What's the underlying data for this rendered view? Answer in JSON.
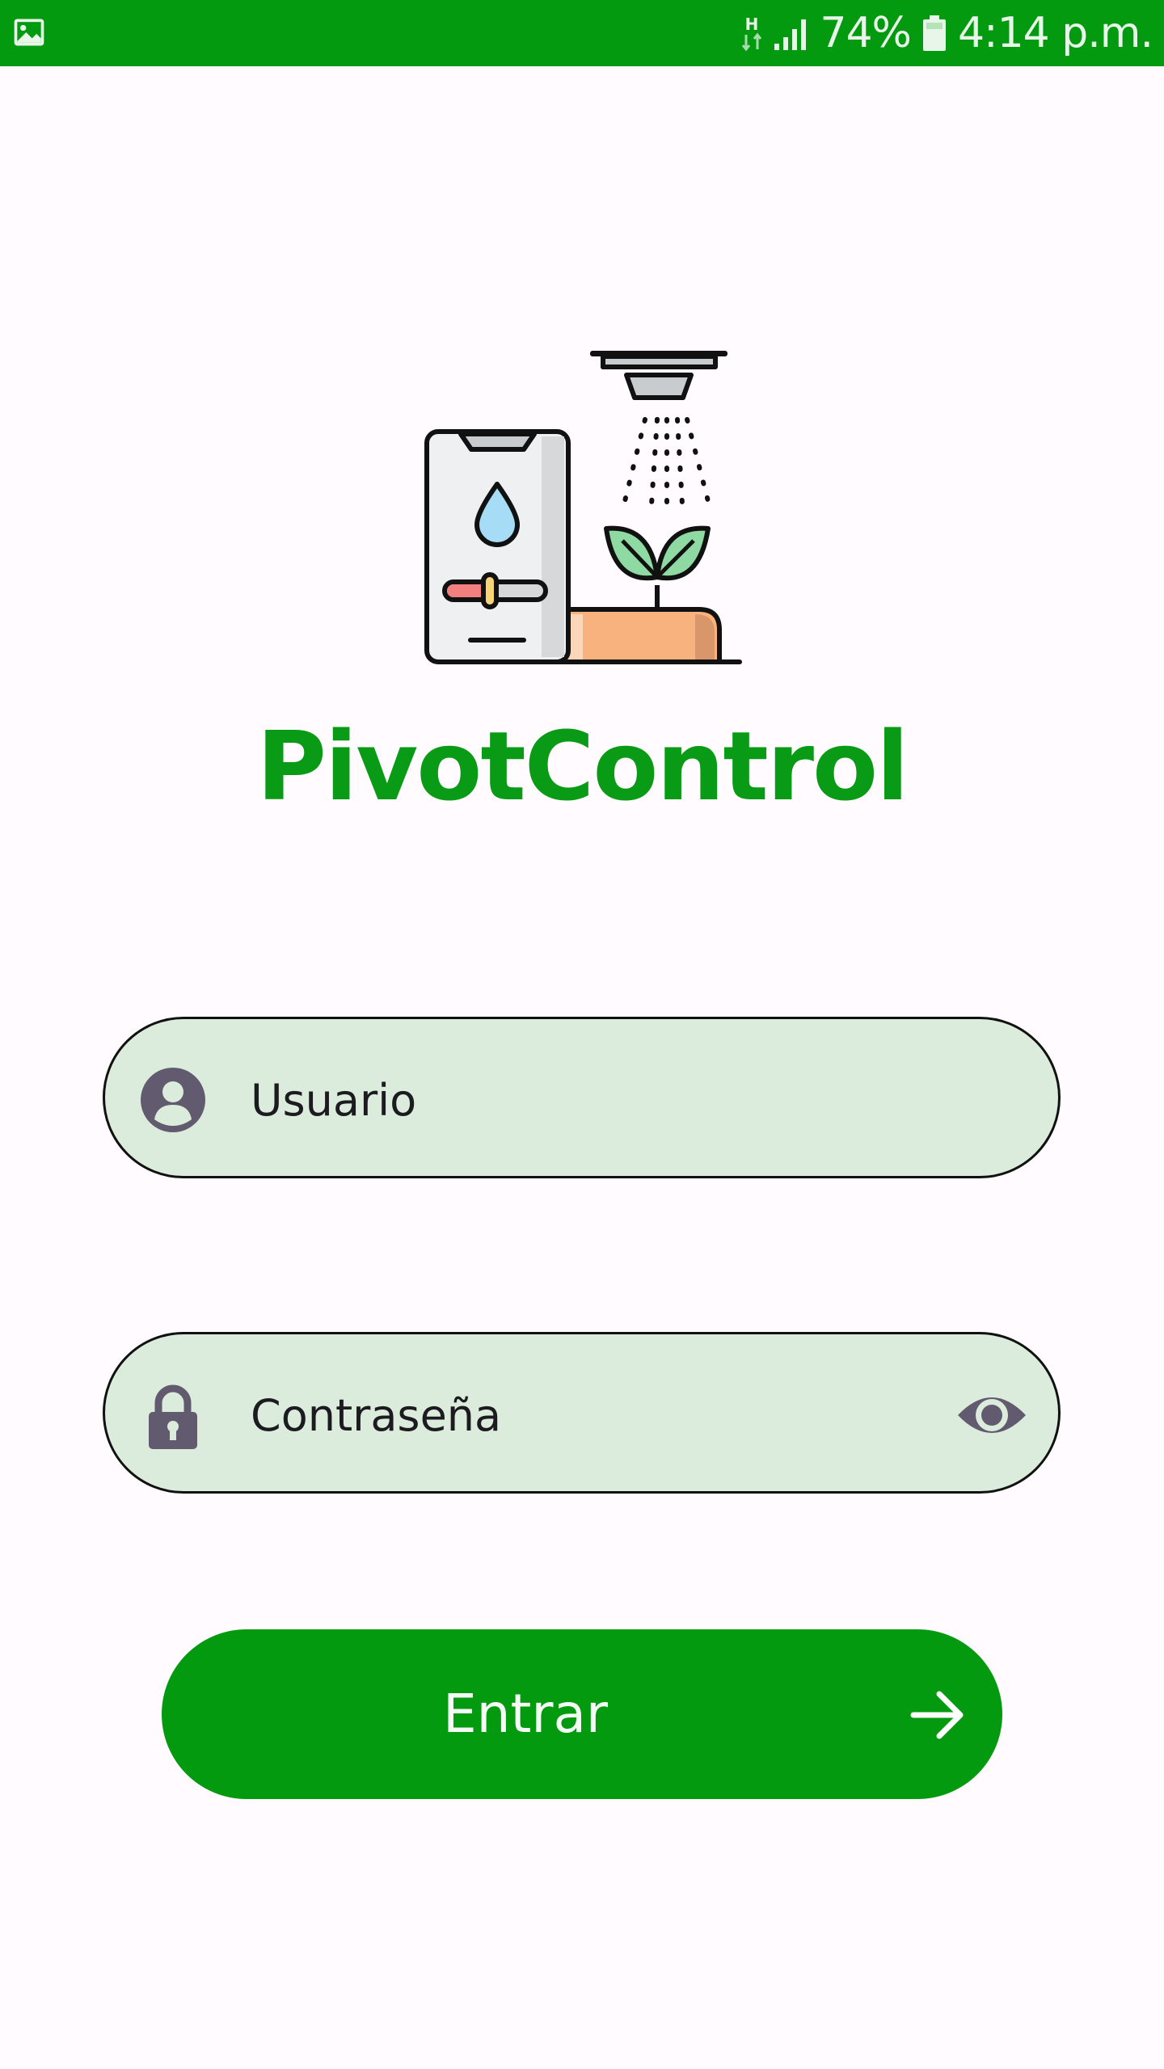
{
  "status_bar": {
    "battery": "74%",
    "time": "4:14 p.m.",
    "network": "H",
    "icons": [
      "image-notification-icon",
      "data-activity-icon",
      "signal-icon",
      "battery-icon"
    ]
  },
  "app": {
    "title": "PivotControl",
    "brand_color": "#0a9b16",
    "logo": "irrigation-phone-plant-logo"
  },
  "login": {
    "username": {
      "placeholder": "Usuario",
      "value": "",
      "icon": "person-icon"
    },
    "password": {
      "placeholder": "Contraseña",
      "value": "",
      "icon": "lock-icon",
      "toggle_icon": "eye-icon"
    },
    "submit": {
      "label": "Entrar",
      "icon": "arrow-right-icon",
      "color": "#049a10"
    },
    "field_background": "#dcecdc"
  }
}
